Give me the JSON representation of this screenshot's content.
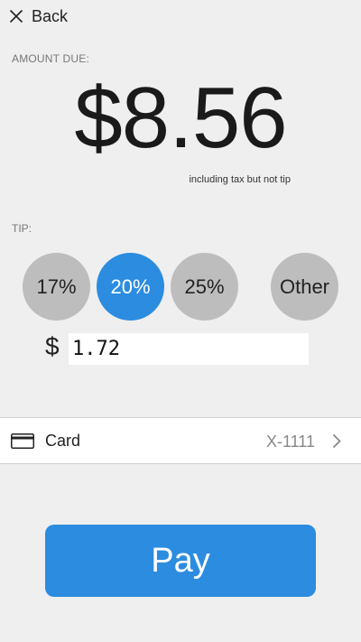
{
  "header": {
    "back_label": "Back",
    "back_icon": "close-icon"
  },
  "amount": {
    "label": "AMOUNT DUE:",
    "value": "$8.56",
    "note": "including tax but not tip"
  },
  "tip": {
    "label": "TIP:",
    "options": [
      "17%",
      "20%",
      "25%",
      "Other"
    ],
    "selected": "20%",
    "currency_symbol": "$",
    "value": "1.72"
  },
  "payment": {
    "icon": "credit-card-icon",
    "label": "Card",
    "number": "X-1111",
    "chevron_icon": "chevron-right-icon"
  },
  "pay_button": {
    "label": "Pay"
  },
  "colors": {
    "accent": "#2b8ce0",
    "background": "#efefef",
    "inactive_option": "#bdbdbd"
  }
}
